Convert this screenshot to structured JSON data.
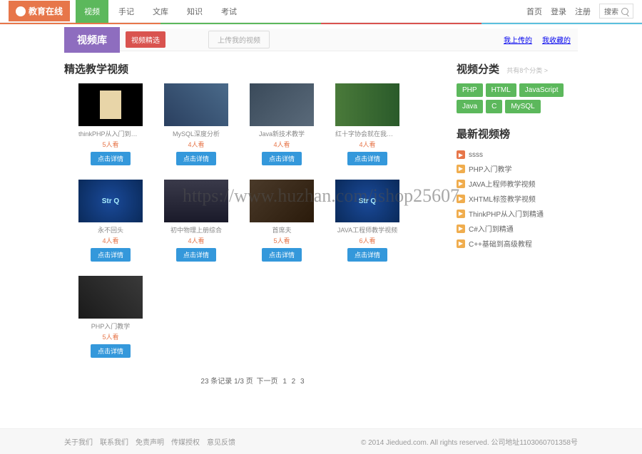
{
  "logo": "教育在线",
  "nav": [
    "视频",
    "手记",
    "文库",
    "知识",
    "考试"
  ],
  "nav_active_index": 0,
  "right_nav": [
    "首页",
    "登录",
    "注册"
  ],
  "search_placeholder": "搜索",
  "header": {
    "title": "视频库",
    "btn": "视频精选",
    "upload": "上传我的视频",
    "links": [
      "我上传的",
      "我收藏的"
    ]
  },
  "section_title": "精选教学视频",
  "videos": [
    {
      "title": "thinkPHP从入门到精通",
      "count": "5人看",
      "btn": "点击详情",
      "thumb": "t1"
    },
    {
      "title": "MySQL深度分析",
      "count": "4人看",
      "btn": "点击详情",
      "thumb": "t2"
    },
    {
      "title": "Java新技术教学",
      "count": "4人看",
      "btn": "点击详情",
      "thumb": "t3"
    },
    {
      "title": "红十字协会就在我们不离",
      "count": "4人看",
      "btn": "点击详情",
      "thumb": "t4"
    },
    {
      "title": "永不回头",
      "count": "4人看",
      "btn": "点击详情",
      "thumb": "t5"
    },
    {
      "title": "初中物理上册综合",
      "count": "4人看",
      "btn": "点击详情",
      "thumb": "t6"
    },
    {
      "title": "首席夫",
      "count": "5人看",
      "btn": "点击详情",
      "thumb": "t7"
    },
    {
      "title": "JAVA工程师教学视频",
      "count": "6人看",
      "btn": "点击详情",
      "thumb": "t8"
    },
    {
      "title": "PHP入门教学",
      "count": "5人看",
      "btn": "点击详情",
      "thumb": "t9"
    }
  ],
  "pagination": {
    "text": "23 条记录 1/3 页",
    "next": "下一页",
    "pages": [
      "1",
      "2",
      "3"
    ]
  },
  "category": {
    "title": "视频分类",
    "sub": "共有8个分类 >",
    "tags": [
      "PHP",
      "HTML",
      "JavaScript",
      "Java",
      "C",
      "MySQL"
    ]
  },
  "latest": {
    "title": "最新视频榜",
    "items": [
      {
        "label": "ssss",
        "hot": true
      },
      {
        "label": "PHP入门教学",
        "hot": false
      },
      {
        "label": "JAVA上程师教学视频",
        "hot": false
      },
      {
        "label": "XHTML标签教学视频",
        "hot": false
      },
      {
        "label": "ThinkPHP从入门到精通",
        "hot": false
      },
      {
        "label": "C#入门到精通",
        "hot": false
      },
      {
        "label": "C++基础到高级教程",
        "hot": false
      }
    ]
  },
  "footer": {
    "links": [
      "关于我们",
      "联系我们",
      "免责声明",
      "传媒授权",
      "意见反馈"
    ],
    "copyright": "© 2014 Jiedued.com. All rights reserved. 公司地址1103060701358号"
  },
  "watermark": "https://www.huzhan.com/ishop25607"
}
